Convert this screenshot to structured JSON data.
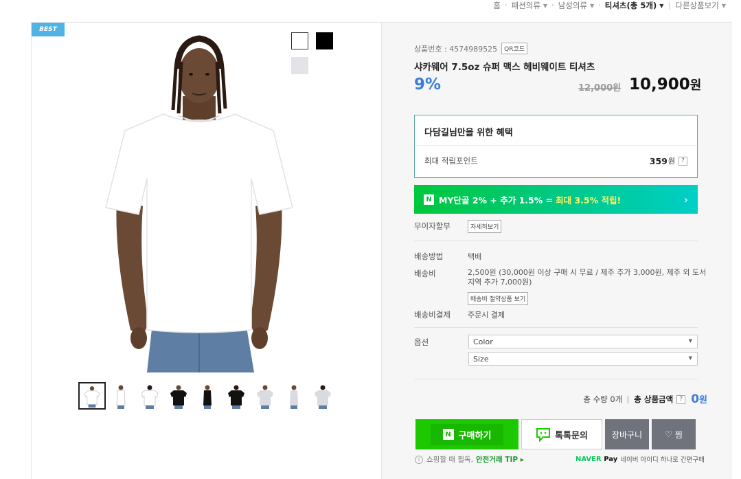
{
  "breadcrumb": {
    "items": [
      "홈",
      "패션의류",
      "남성의류"
    ],
    "current": "티셔츠(총 5개)",
    "other": "다른상품보기"
  },
  "badge": "BEST",
  "color_swatches": [
    {
      "name": "white",
      "color": "#ffffff"
    },
    {
      "name": "black",
      "color": "#000000"
    },
    {
      "name": "grey",
      "color": "#e3e4e8"
    }
  ],
  "thumbnails": [
    "white-front",
    "white-side",
    "white-back",
    "black-front",
    "black-side",
    "black-back",
    "grey-front",
    "grey-side",
    "grey-back"
  ],
  "product": {
    "number_label": "상품번호 : 4574989525",
    "qr_label": "QR코드",
    "title": "샤카웨어 7.5oz 슈퍼 맥스 헤비웨이트 티셔츠",
    "discount": "9%",
    "original_price": "12,000원",
    "price": "10,900",
    "price_unit": "원"
  },
  "benefit": {
    "heading": "다담길님만을 위한 혜택",
    "label": "최대 적립포인트",
    "points": "359",
    "points_unit": "원",
    "help": "?"
  },
  "naver_banner": {
    "logo": "N",
    "text": "MY단골 2% + 추가 1.5% =",
    "highlight": "최대 3.5% 적립!",
    "arrow": "›"
  },
  "installment": {
    "label": "무이자할부",
    "button": "자세히보기"
  },
  "shipping": {
    "method_label": "배송방법",
    "method_value": "택배",
    "fee_label": "배송비",
    "fee_value_1": "2,500원 (30,000원 이상 구매 시 무료 / 제주 추가 3,000원, 제주 외 도서",
    "fee_value_2": "지역 추가 7,000원)",
    "fee_button": "배송비 절약상품 보기",
    "payment_label": "배송비결제",
    "payment_value": "주문시 결제"
  },
  "options": {
    "label": "옵션",
    "color_select": "Color",
    "size_select": "Size"
  },
  "total": {
    "quantity_text": "총 수량 0개",
    "amount_label": "총 상품금액",
    "help": "?",
    "amount": "0",
    "unit": "원"
  },
  "buttons": {
    "buy": "구매하기",
    "talk": "톡톡문의",
    "cart": "장바구니",
    "wish": "찜"
  },
  "footer": {
    "info": "i",
    "text": "쇼핑할 때 필독,",
    "tip": "안전거래 TIP ▸",
    "npay_brand_1": "NAVER",
    "npay_brand_2": "Pay",
    "npay_text": "네이버 아이디 하나로 간편구매"
  },
  "colors": {
    "accent_blue": "#3b7ed9",
    "naver_green": "#1ec800",
    "badge_blue": "#4fb3e6",
    "grey_button": "#70737c"
  }
}
